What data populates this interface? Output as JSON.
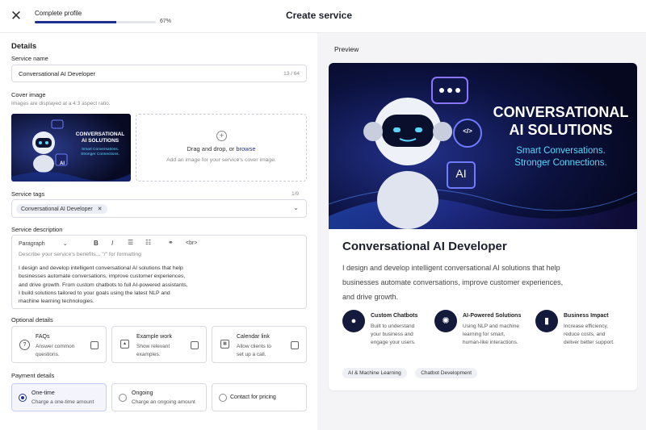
{
  "header": {
    "progress_label": "Complete profile",
    "progress_percent": "67%",
    "progress_value": 0.67,
    "title": "Create service",
    "close_icon": "close-icon"
  },
  "details": {
    "heading": "Details",
    "service_name_label": "Service name",
    "service_name_value": "Conversational AI Developer",
    "service_name_counter": "13 / 64",
    "cover_label": "Cover image",
    "cover_hint": "Images are displayed at a 4:3 aspect ratio.",
    "drop_text": "Drag and drop, or",
    "drop_link": "browse",
    "drop_sub": "Add an image for your service's cover image.",
    "tags_label": "Service tags",
    "tags_counter": "1/9",
    "tag_chip": "Conversational AI Developer",
    "desc_label": "Service description",
    "toolbar_paragraph": "Paragraph",
    "toolbar_br": "<br>",
    "desc_placeholder": "Describe your service's benefits... \"/\" for formatting",
    "desc_lines": [
      "I design and develop intelligent conversational AI solutions that help",
      "businesses automate conversations, improve customer experiences,",
      "and drive growth. From custom chatbots to full AI-powered assistants,",
      "I build solutions tailored to your goals using the latest NLP and",
      "machine learning technologies."
    ]
  },
  "thumb": {
    "line1": "CONVERSATIONAL",
    "line2": "AI SOLUTIONS",
    "line3": "Smart Conversations.",
    "line4": "Stronger Connections."
  },
  "optional": {
    "heading": "Optional details",
    "items": [
      {
        "title": "FAQs",
        "desc1": "Answer common",
        "desc2": "questions."
      },
      {
        "title": "Example work",
        "desc1": "Show relevant",
        "desc2": "examples."
      },
      {
        "title": "Calendar link",
        "desc1": "Allow clients to",
        "desc2": "set up a call."
      }
    ]
  },
  "payment": {
    "heading": "Payment details",
    "one_time": "One-time",
    "one_time_sub": "Charge a one-time amount",
    "ongoing": "Ongoing",
    "ongoing_sub": "Charge an ongoing amount",
    "contact": "Contact for pricing"
  },
  "preview": {
    "heading": "Preview",
    "banner_line1": "CONVERSATIONAL",
    "banner_line2": "AI SOLUTIONS",
    "banner_line3": "Smart Conversations.",
    "banner_line4": "Stronger Connections.",
    "banner_ai": "AI",
    "banner_code": "</>",
    "title": "Conversational AI Developer",
    "desc_lines": [
      "I design and develop intelligent conversational AI solutions that help",
      "businesses automate conversations, improve customer experiences,",
      "and drive growth."
    ],
    "features": [
      {
        "title": "Custom Chatbots",
        "d1": "Built to understand",
        "d2": "your business and",
        "d3": "engage your users.",
        "icon": "chat-bubble-icon"
      },
      {
        "title": "AI-Powered Solutions",
        "d1": "Using NLP and machine",
        "d2": "learning for smart,",
        "d3": "human-like interactions.",
        "icon": "brain-icon"
      },
      {
        "title": "Business Impact",
        "d1": "Increase efficiency,",
        "d2": "reduce costs, and",
        "d3": "deliver better support.",
        "icon": "bar-chart-icon"
      }
    ],
    "tags": [
      "AI & Machine Learning",
      "Chatbot Development"
    ]
  },
  "colors": {
    "accent": "#1f2f8f",
    "banner_bg": "#0b1030",
    "banner_text": "#ffffff",
    "banner_cyan": "#59d8ff"
  }
}
